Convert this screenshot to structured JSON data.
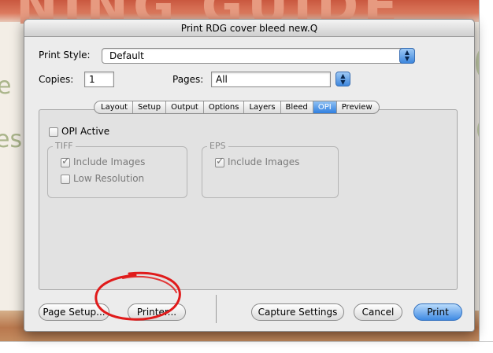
{
  "window": {
    "title": "Print RDG cover bleed new.Q"
  },
  "background": {
    "banner_text": "NING GUIDE",
    "side_letters": [
      "e",
      "es"
    ]
  },
  "print_style": {
    "label": "Print Style:",
    "value": "Default"
  },
  "copies": {
    "label": "Copies:",
    "value": "1"
  },
  "pages": {
    "label": "Pages:",
    "value": "All"
  },
  "tabs": [
    {
      "label": "Layout",
      "active": false
    },
    {
      "label": "Setup",
      "active": false
    },
    {
      "label": "Output",
      "active": false
    },
    {
      "label": "Options",
      "active": false
    },
    {
      "label": "Layers",
      "active": false
    },
    {
      "label": "Bleed",
      "active": false
    },
    {
      "label": "OPI",
      "active": true
    },
    {
      "label": "Preview",
      "active": false
    }
  ],
  "opi": {
    "active_label": "OPI Active",
    "active_checked": false,
    "tiff": {
      "label": "TIFF",
      "include_images": {
        "label": "Include Images",
        "checked": true
      },
      "low_resolution": {
        "label": "Low Resolution",
        "checked": false
      }
    },
    "eps": {
      "label": "EPS",
      "include_images": {
        "label": "Include Images",
        "checked": true
      }
    }
  },
  "buttons": {
    "page_setup": "Page Setup...",
    "printer": "Printer...",
    "capture_settings": "Capture Settings",
    "cancel": "Cancel",
    "print": "Print"
  },
  "colors": {
    "accent": "#3f8ae3",
    "annotation_circle": "#e01b1b"
  },
  "icons": {
    "popup_arrows": "up-down-arrows-icon",
    "checkmark": "checkmark-icon"
  }
}
